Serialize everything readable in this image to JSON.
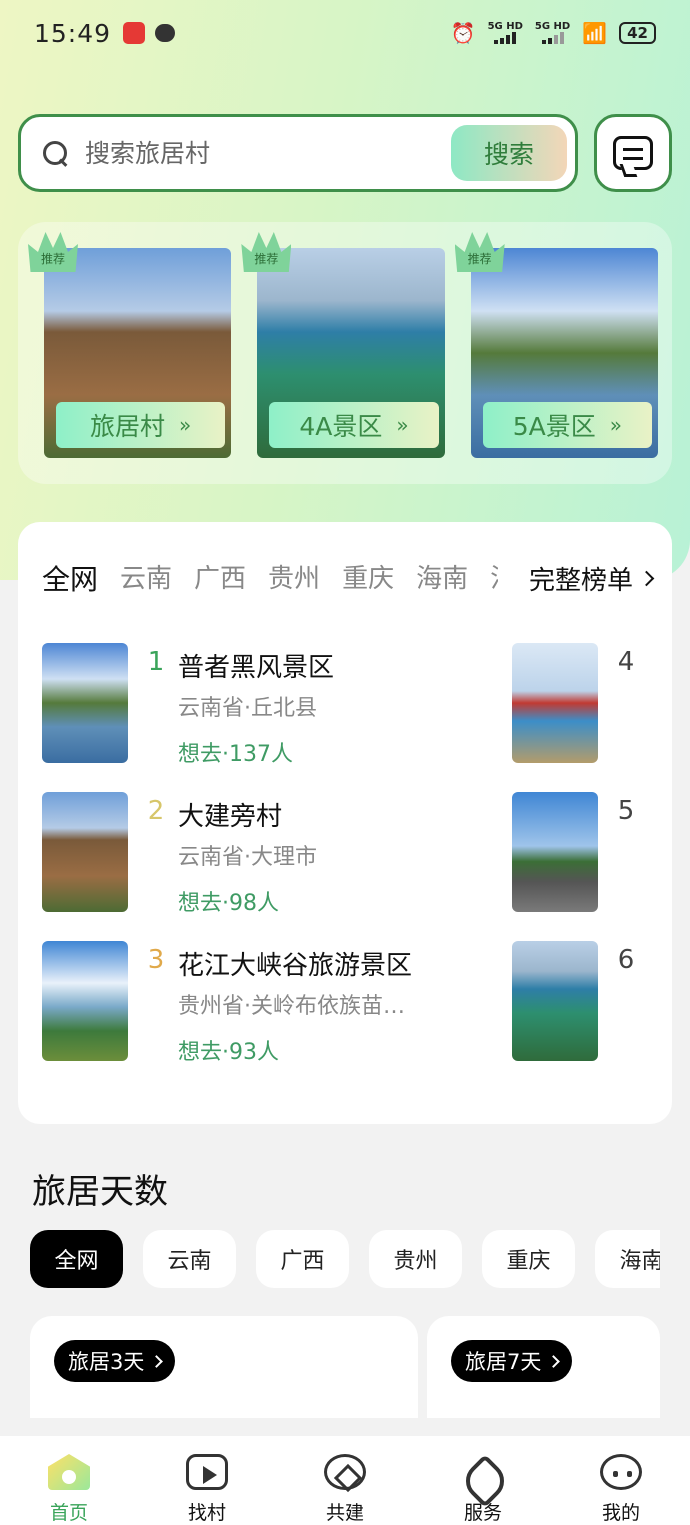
{
  "status_bar": {
    "time": "15:49",
    "signal1": "5G HD",
    "signal2": "5G HD",
    "battery": "42"
  },
  "search": {
    "placeholder": "搜索旅居村",
    "button_label": "搜索"
  },
  "recommend": {
    "badge": "推荐",
    "cards": [
      {
        "label": "旅居村"
      },
      {
        "label": "4A景区"
      },
      {
        "label": "5A景区"
      }
    ]
  },
  "ranking": {
    "tabs": [
      "全网",
      "云南",
      "广西",
      "贵州",
      "重庆",
      "海南",
      "江"
    ],
    "full_list": "完整榜单",
    "items": [
      {
        "rank": "1",
        "name": "普者黑风景区",
        "location": "云南省·丘北县",
        "want": "想去·137人"
      },
      {
        "rank": "2",
        "name": "大建旁村",
        "location": "云南省·大理市",
        "want": "想去·98人"
      },
      {
        "rank": "3",
        "name": "花江大峡谷旅游景区",
        "location": "贵州省·关岭布依族苗…",
        "want": "想去·93人"
      },
      {
        "rank": "4"
      },
      {
        "rank": "5"
      },
      {
        "rank": "6"
      }
    ]
  },
  "days": {
    "title": "旅居天数",
    "tabs": [
      "全网",
      "云南",
      "广西",
      "贵州",
      "重庆",
      "海南"
    ],
    "cards": [
      {
        "label": "旅居3天"
      },
      {
        "label": "旅居7天"
      }
    ]
  },
  "bottom_nav": [
    {
      "label": "首页",
      "icon": "home-icon"
    },
    {
      "label": "找村",
      "icon": "video-icon"
    },
    {
      "label": "共建",
      "icon": "build-icon"
    },
    {
      "label": "服务",
      "icon": "service-icon"
    },
    {
      "label": "我的",
      "icon": "mine-icon"
    }
  ],
  "colors": {
    "accent": "#3aa45a",
    "border": "#3f8f4a",
    "want_text": "#3f9b64"
  }
}
